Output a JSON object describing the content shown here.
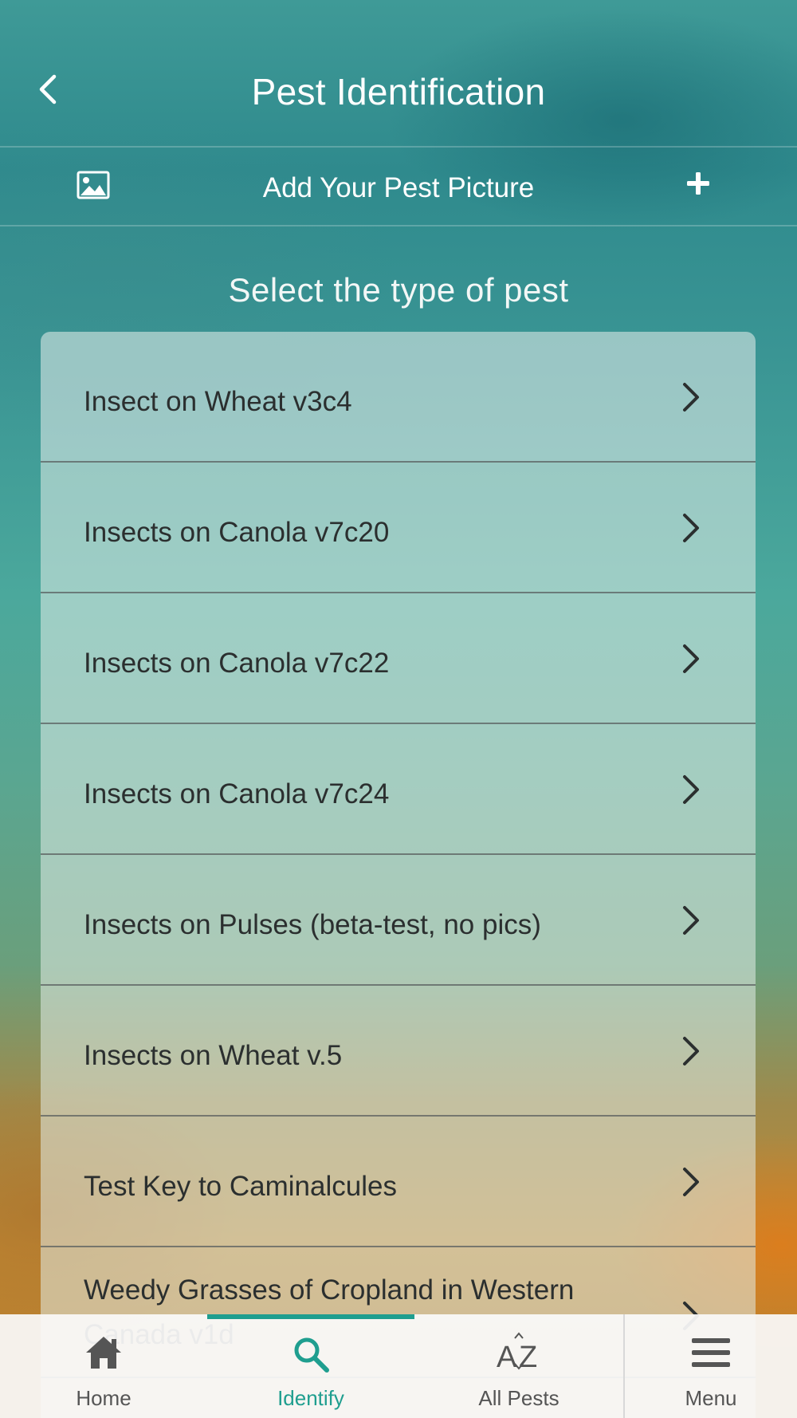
{
  "header": {
    "title": "Pest Identification"
  },
  "add_picture": {
    "label": "Add Your Pest Picture"
  },
  "section": {
    "title": "Select the type of pest"
  },
  "pest_types": [
    "Insect on Wheat v3c4",
    "Insects on Canola v7c20",
    "Insects on Canola v7c22",
    "Insects on Canola v7c24",
    "Insects on Pulses (beta-test, no pics)",
    "Insects on Wheat v.5",
    "Test Key to Caminalcules",
    "Weedy Grasses of Cropland in Western Canada v1d"
  ],
  "bottom_nav": {
    "items": [
      {
        "label": "Home",
        "icon": "home-icon",
        "active": false
      },
      {
        "label": "Identify",
        "icon": "search-icon",
        "active": true
      },
      {
        "label": "All Pests",
        "icon": "az-sort-icon",
        "active": false
      },
      {
        "label": "Menu",
        "icon": "hamburger-menu-icon",
        "active": false
      }
    ]
  },
  "colors": {
    "accent": "#1f9e8f",
    "header_text": "#ffffff",
    "list_text": "#2b2f2f",
    "nav_inactive": "#555555"
  }
}
